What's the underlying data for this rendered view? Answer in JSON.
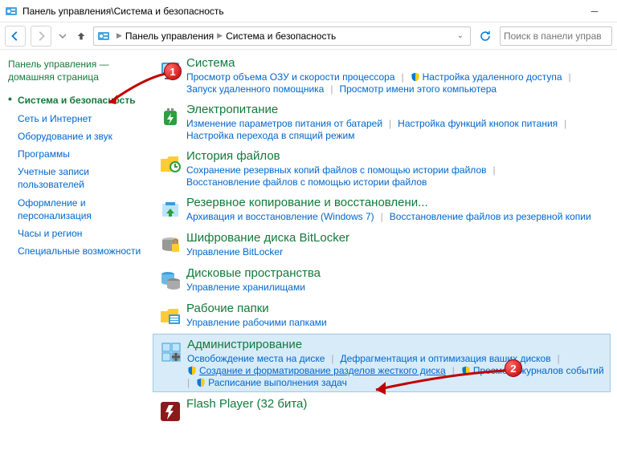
{
  "window": {
    "title": "Панель управления\\Система и безопасность"
  },
  "breadcrumb": {
    "root": "Панель управления",
    "current": "Система и безопасность"
  },
  "search": {
    "placeholder": "Поиск в панели управ"
  },
  "sidebar": {
    "home": "Панель управления — домашняя страница",
    "items": [
      "Система и безопасность",
      "Сеть и Интернет",
      "Оборудование и звук",
      "Программы",
      "Учетные записи пользователей",
      "Оформление и персонализация",
      "Часы и регион",
      "Специальные возможности"
    ]
  },
  "categories": [
    {
      "title": "Система",
      "links": [
        {
          "label": "Просмотр объема ОЗУ и скорости процессора",
          "shield": false
        },
        {
          "label": "Настройка удаленного доступа",
          "shield": true
        },
        {
          "label": "Запуск удаленного помощника",
          "shield": false
        },
        {
          "label": "Просмотр имени этого компьютера",
          "shield": false
        }
      ]
    },
    {
      "title": "Электропитание",
      "links": [
        {
          "label": "Изменение параметров питания от батарей",
          "shield": false
        },
        {
          "label": "Настройка функций кнопок питания",
          "shield": false
        },
        {
          "label": "Настройка перехода в спящий режим",
          "shield": false
        }
      ]
    },
    {
      "title": "История файлов",
      "links": [
        {
          "label": "Сохранение резервных копий файлов с помощью истории файлов",
          "shield": false
        },
        {
          "label": "Восстановление файлов с помощью истории файлов",
          "shield": false
        }
      ]
    },
    {
      "title": "Резервное копирование и восстановлени...",
      "links": [
        {
          "label": "Архивация и восстановление (Windows 7)",
          "shield": false
        },
        {
          "label": "Восстановление файлов из резервной копии",
          "shield": false
        }
      ]
    },
    {
      "title": "Шифрование диска BitLocker",
      "links": [
        {
          "label": "Управление BitLocker",
          "shield": false
        }
      ]
    },
    {
      "title": "Дисковые пространства",
      "links": [
        {
          "label": "Управление хранилищами",
          "shield": false
        }
      ]
    },
    {
      "title": "Рабочие папки",
      "links": [
        {
          "label": "Управление рабочими папками",
          "shield": false
        }
      ]
    },
    {
      "title": "Администрирование",
      "highlight": true,
      "links": [
        {
          "label": "Освобождение места на диске",
          "shield": false
        },
        {
          "label": "Дефрагментация и оптимизация ваших дисков",
          "shield": false
        },
        {
          "label": "Создание и форматирование разделов жесткого диска",
          "shield": true,
          "underlined": true
        },
        {
          "label": "Просмотр журналов событий",
          "shield": true
        },
        {
          "label": "Расписание выполнения задач",
          "shield": true
        }
      ]
    },
    {
      "title": "Flash Player (32 бита)",
      "links": []
    }
  ],
  "annotations": {
    "step1": "1",
    "step2": "2"
  }
}
